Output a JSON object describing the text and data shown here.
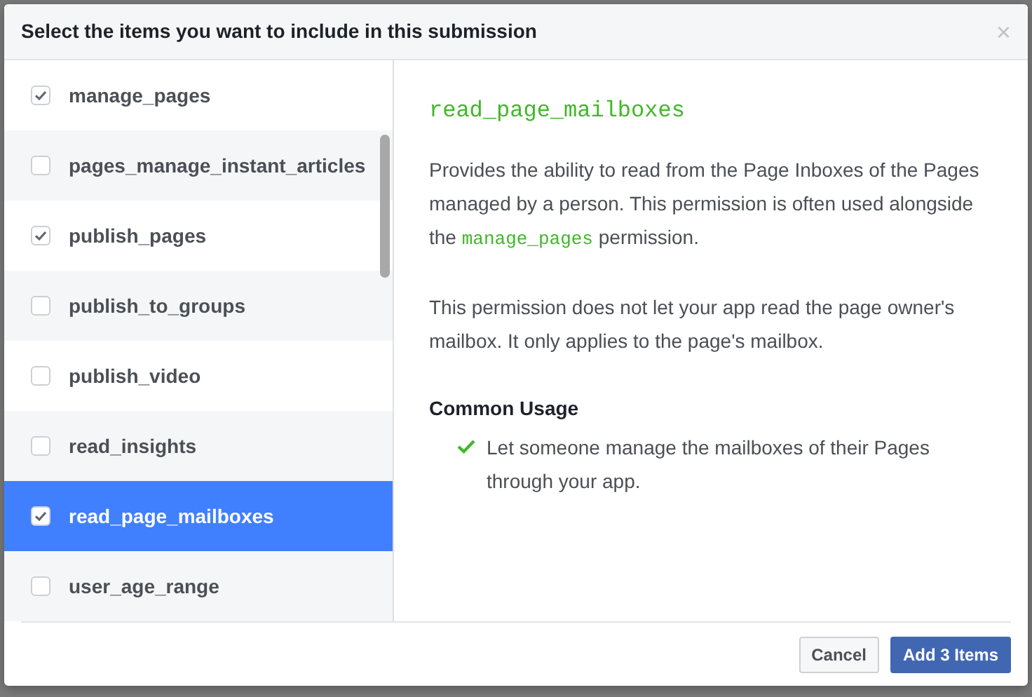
{
  "dialog": {
    "title": "Select the items you want to include in this submission",
    "close": "×",
    "items": [
      {
        "label": "manage_pages",
        "checked": true,
        "selected": false
      },
      {
        "label": "pages_manage_instant_articles",
        "checked": false,
        "selected": false
      },
      {
        "label": "publish_pages",
        "checked": true,
        "selected": false
      },
      {
        "label": "publish_to_groups",
        "checked": false,
        "selected": false
      },
      {
        "label": "publish_video",
        "checked": false,
        "selected": false
      },
      {
        "label": "read_insights",
        "checked": false,
        "selected": false
      },
      {
        "label": "read_page_mailboxes",
        "checked": true,
        "selected": true
      },
      {
        "label": "user_age_range",
        "checked": false,
        "selected": false
      }
    ],
    "detail": {
      "title": "read_page_mailboxes",
      "paragraphs": [
        [
          {
            "kind": "text",
            "text": "Provides the ability to read from the Page Inboxes of the Pages managed by a person. This permission is often used alongside the"
          },
          {
            "kind": "code",
            "text": "manage_pages"
          },
          {
            "kind": "text",
            "text": "permission."
          }
        ],
        [
          {
            "kind": "text",
            "text": "This permission does not let your app read the page owner's mailbox. It only applies to the page's mailbox."
          }
        ]
      ],
      "usage_heading": "Common Usage",
      "usage": [
        "Let someone manage the mailboxes of their Pages through your app."
      ]
    },
    "buttons": [
      {
        "label": "Cancel",
        "kind": "secondary"
      },
      {
        "label": "Add 3 Items",
        "kind": "primary"
      }
    ]
  }
}
